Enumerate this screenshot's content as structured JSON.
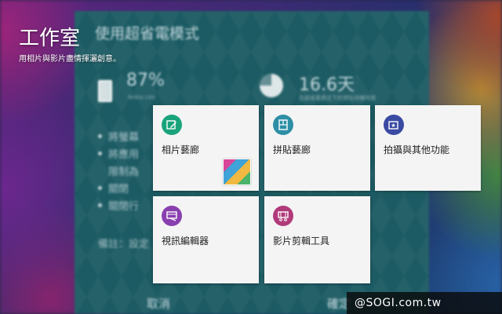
{
  "header": {
    "title": "工作室",
    "subtitle": "用相片與影片盡情揮灑創意。"
  },
  "background_dialog": {
    "title": "使用超省電模式",
    "battery_percent": "87%",
    "battery_sub": "Nokia Lite",
    "days": "16.6天",
    "days_sub": "在超省電模式下的預估待機時間",
    "bullets": [
      "將螢幕",
      "將應用",
      "限制為",
      "關閉",
      "關閉行"
    ],
    "note": "備註：設定",
    "cancel_label": "取消",
    "ok_label": "確定"
  },
  "tiles": [
    {
      "label": "相片藝廊",
      "icon": "photo-editor-icon",
      "color": "#1aa37a",
      "has_thumbnail": true
    },
    {
      "label": "拼貼藝廊",
      "icon": "collage-icon",
      "color": "#2d8fa6",
      "has_thumbnail": false
    },
    {
      "label": "拍攝與其他功能",
      "icon": "camera-studio-icon",
      "color": "#3a4aa3",
      "has_thumbnail": false
    },
    {
      "label": "視訊編輯器",
      "icon": "video-editor-icon",
      "color": "#8a3fb0",
      "has_thumbnail": false
    },
    {
      "label": "影片剪輯工具",
      "icon": "video-trimmer-icon",
      "color": "#b03a7a",
      "has_thumbnail": false
    }
  ],
  "watermark": "@SOGI.com.tw"
}
